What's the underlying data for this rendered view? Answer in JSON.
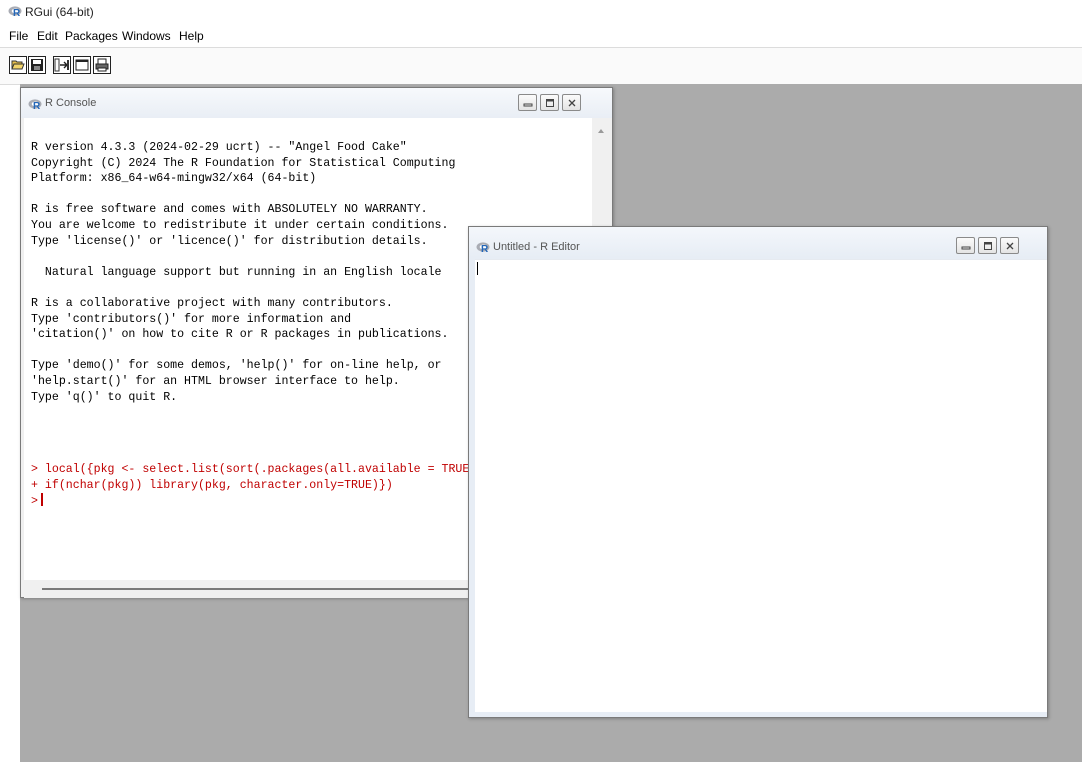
{
  "app": {
    "title": "RGui (64-bit)"
  },
  "menu": [
    "File",
    "Edit",
    "Packages",
    "Windows",
    "Help"
  ],
  "toolbar": {
    "buttons": [
      "open-script-icon",
      "save-icon",
      "load-workspace-icon",
      "new-window-icon",
      "print-icon"
    ]
  },
  "console": {
    "title": "R Console",
    "output_lines": [
      "R version 4.3.3 (2024-02-29 ucrt) -- \"Angel Food Cake\"",
      "Copyright (C) 2024 The R Foundation for Statistical Computing",
      "Platform: x86_64-w64-mingw32/x64 (64-bit)",
      "",
      "R is free software and comes with ABSOLUTELY NO WARRANTY.",
      "You are welcome to redistribute it under certain conditions.",
      "Type 'license()' or 'licence()' for distribution details.",
      "",
      "  Natural language support but running in an English locale",
      "",
      "R is a collaborative project with many contributors.",
      "Type 'contributors()' for more information and",
      "'citation()' on how to cite R or R packages in publications.",
      "",
      "Type 'demo()' for some demos, 'help()' for on-line help, or",
      "'help.start()' for an HTML browser interface to help.",
      "Type 'q()' to quit R."
    ],
    "command_lines": [
      "> local({pkg <- select.list(sort(.packages(all.available = TRUE",
      "+ if(nchar(pkg)) library(pkg, character.only=TRUE)})"
    ],
    "prompt": ">"
  },
  "editor": {
    "title": "Untitled - R Editor"
  },
  "colors": {
    "mdi_background": "#ababab",
    "command_text": "#c00000",
    "r_logo": "#2266b8"
  }
}
